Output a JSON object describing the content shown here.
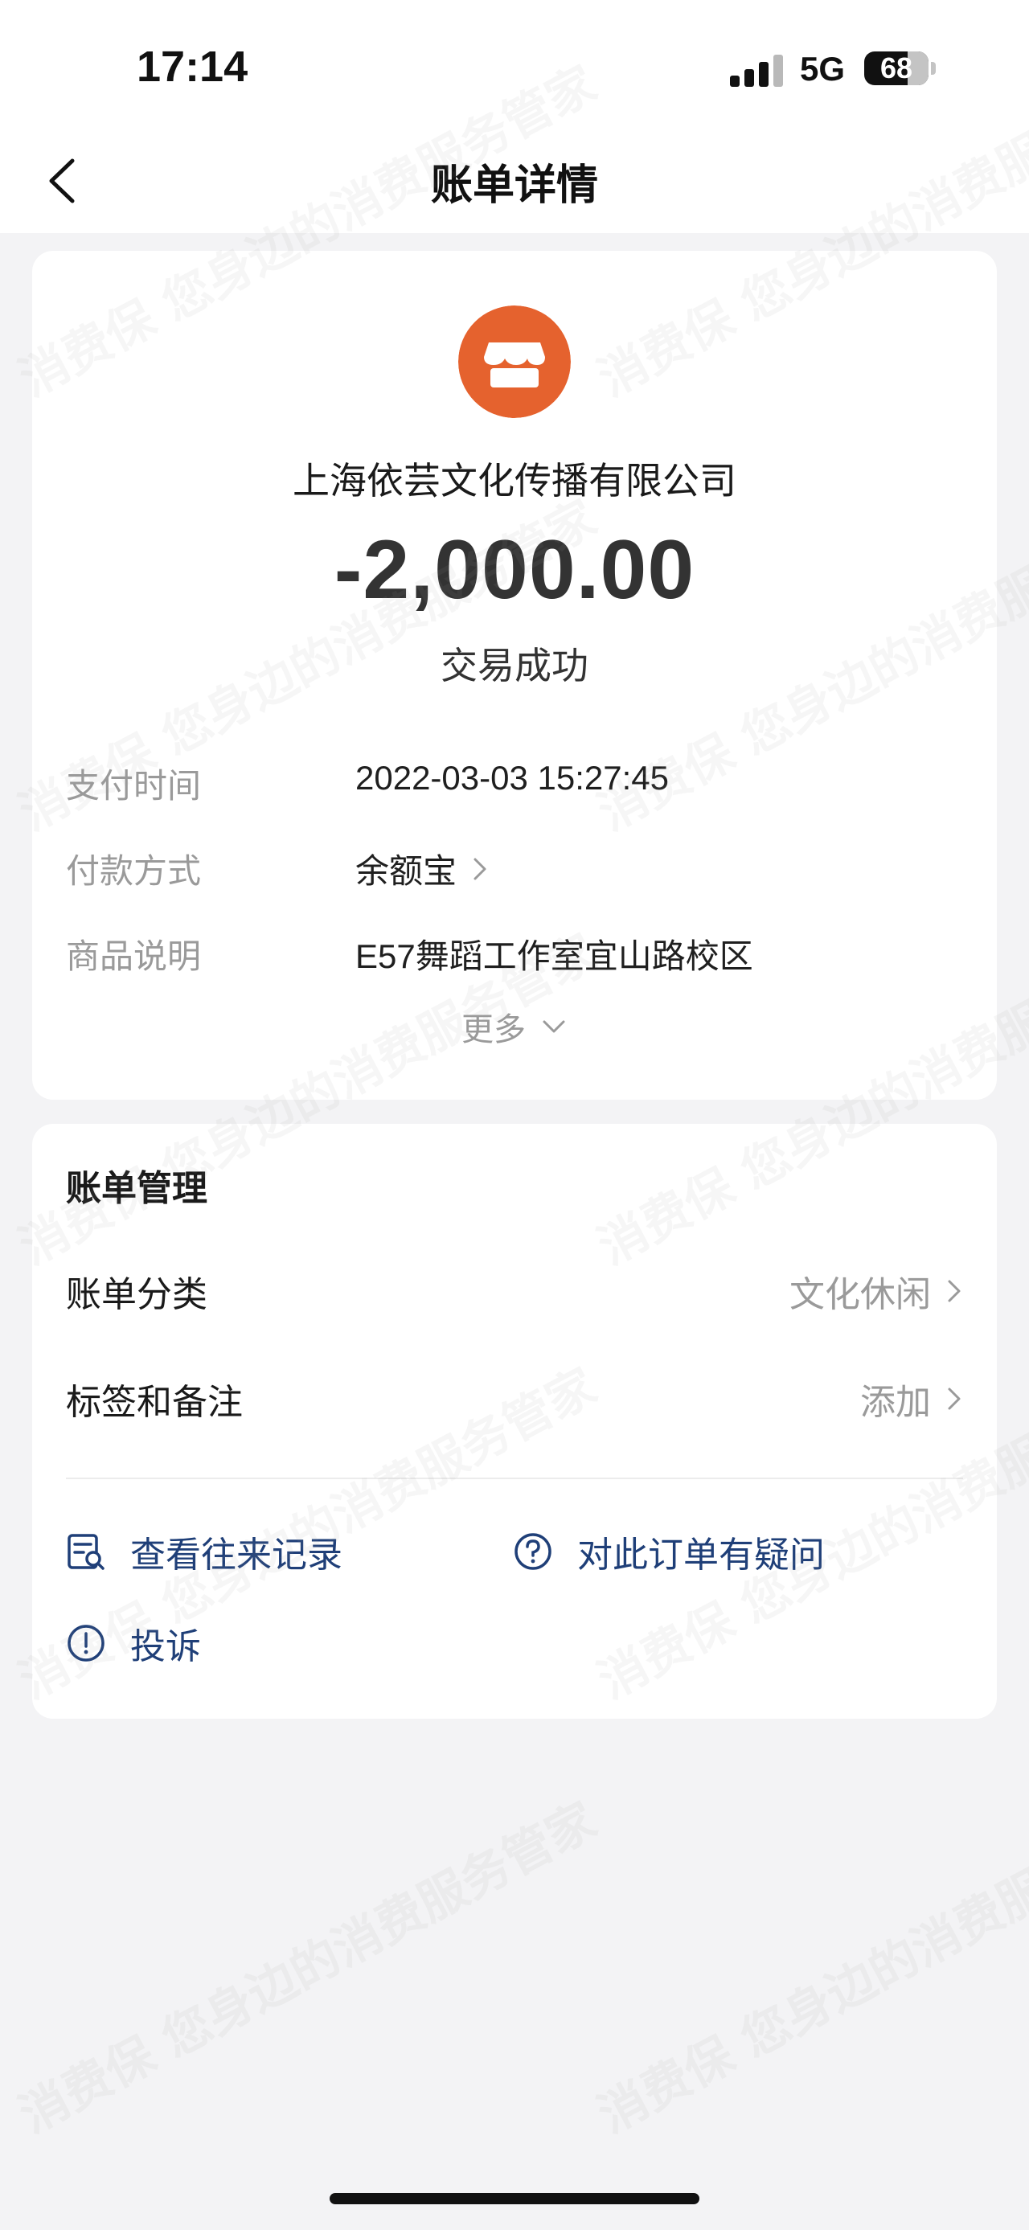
{
  "status_bar": {
    "time": "17:14",
    "network": "5G",
    "battery": "68",
    "battery_level": 0.68
  },
  "nav": {
    "title": "账单详情",
    "back_icon": "chevron-left-icon"
  },
  "transaction": {
    "merchant_icon": "store-icon",
    "merchant_color": "#e5622e",
    "merchant_name": "上海依芸文化传播有限公司",
    "amount": "-2,000.00",
    "status": "交易成功",
    "details": {
      "time_label": "支付时间",
      "time_value": "2022-03-03 15:27:45",
      "pay_label": "付款方式",
      "pay_value": "余额宝",
      "goods_label": "商品说明",
      "goods_value": "E57舞蹈工作室宜山路校区"
    },
    "more_label": "更多"
  },
  "manage": {
    "title": "账单管理",
    "category_label": "账单分类",
    "category_value": "文化休闲",
    "tag_label": "标签和备注",
    "tag_value": "添加",
    "actions": {
      "history": "查看往来记录",
      "question": "对此订单有疑问",
      "complain": "投诉"
    }
  },
  "watermark_text": "消费保 您身边的消费服务管家",
  "colors": {
    "accent_link": "#1f3f78",
    "merchant": "#e5622e",
    "muted": "#9a9a9a"
  }
}
